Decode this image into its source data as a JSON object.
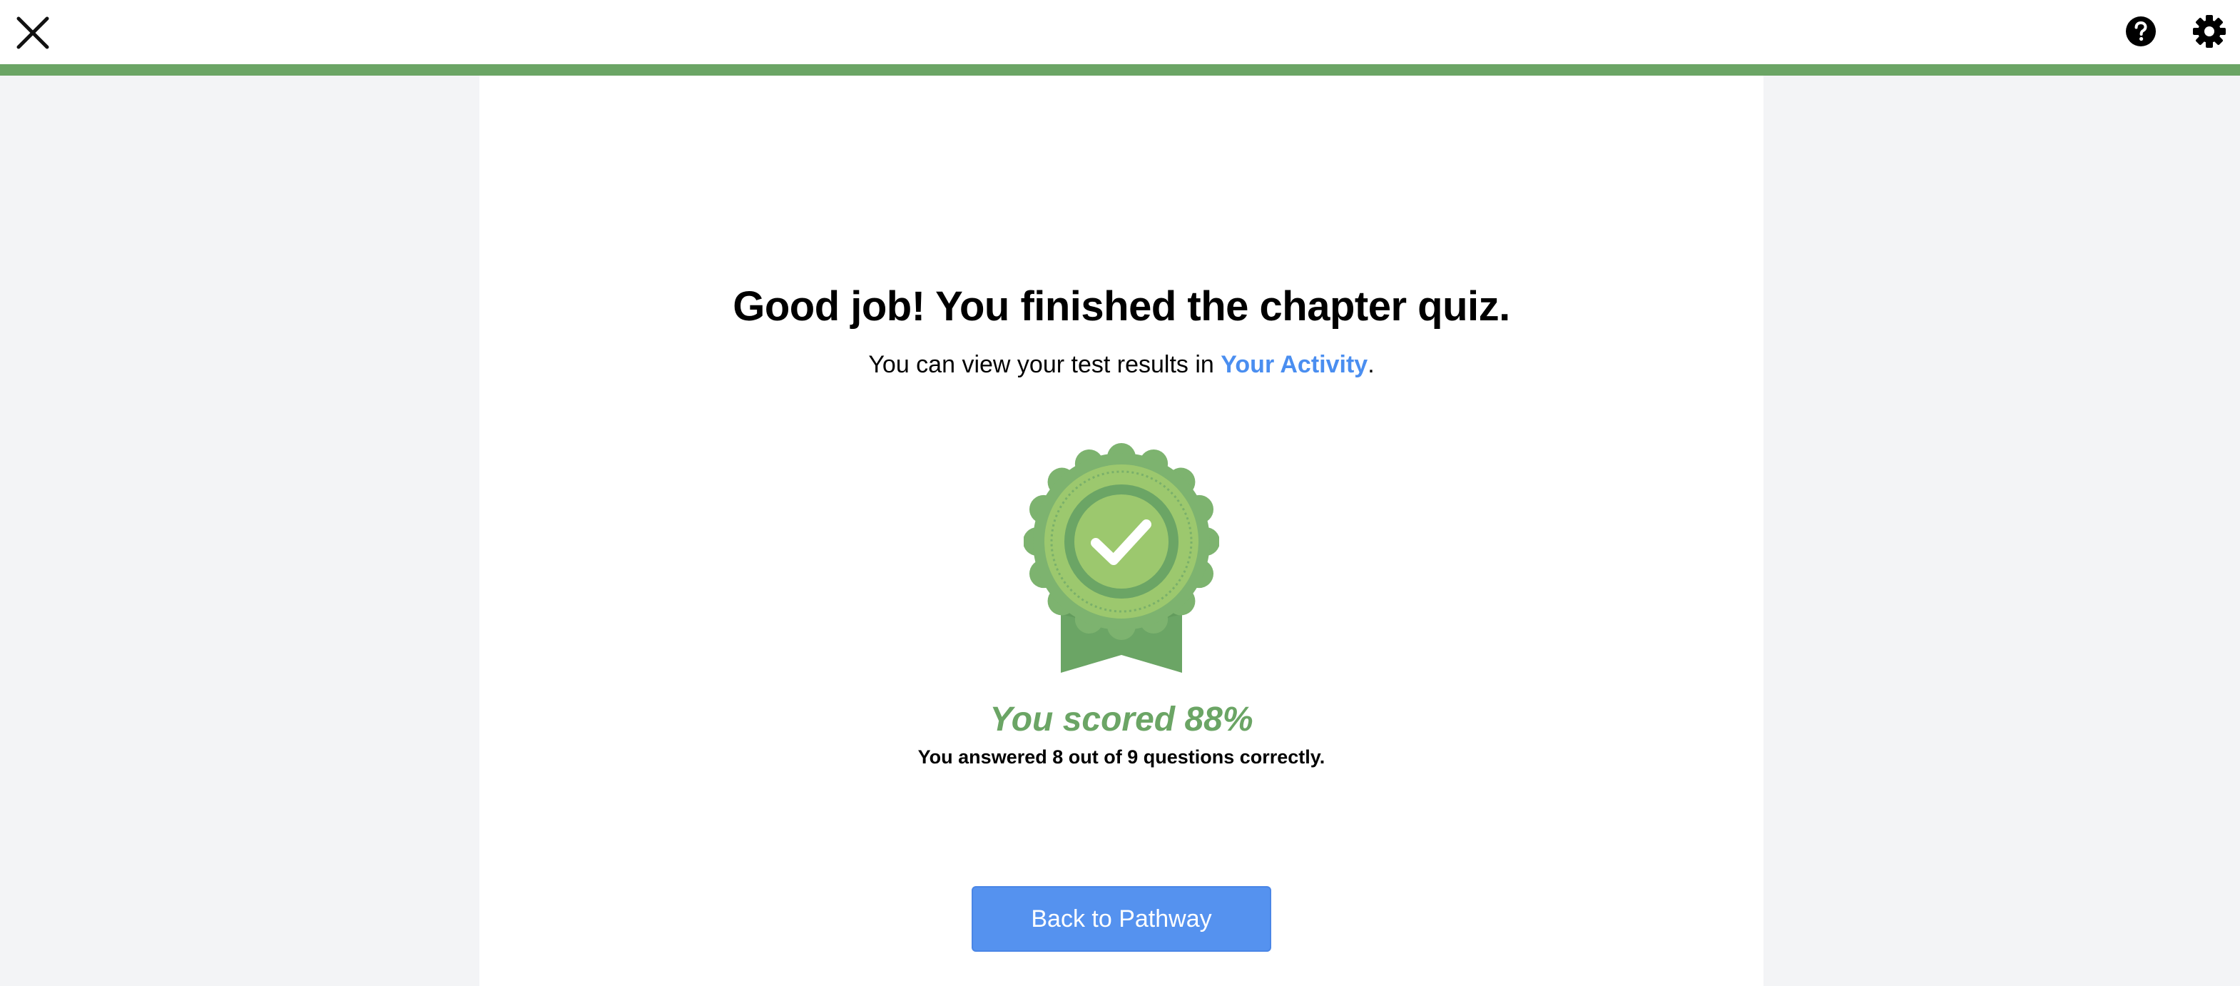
{
  "header": {
    "close_icon": "close-icon",
    "help_icon": "help-icon",
    "settings_icon": "gear-icon"
  },
  "progress": {
    "fraction": 1.0,
    "color": "#6ba565"
  },
  "result": {
    "title": "Good job! You finished the chapter quiz.",
    "subtitle_prefix": "You can view your test results in ",
    "subtitle_link": "Your Activity",
    "subtitle_suffix": ".",
    "badge_icon": "award-ribbon-checkmark-icon",
    "score_text": "You scored 88%",
    "detail_text": "You answered 8 out of 9 questions correctly.",
    "back_button_label": "Back to Pathway"
  },
  "colors": {
    "accent_green": "#6ba565",
    "link_blue": "#4a8ef0",
    "button_blue": "#5592ef"
  }
}
